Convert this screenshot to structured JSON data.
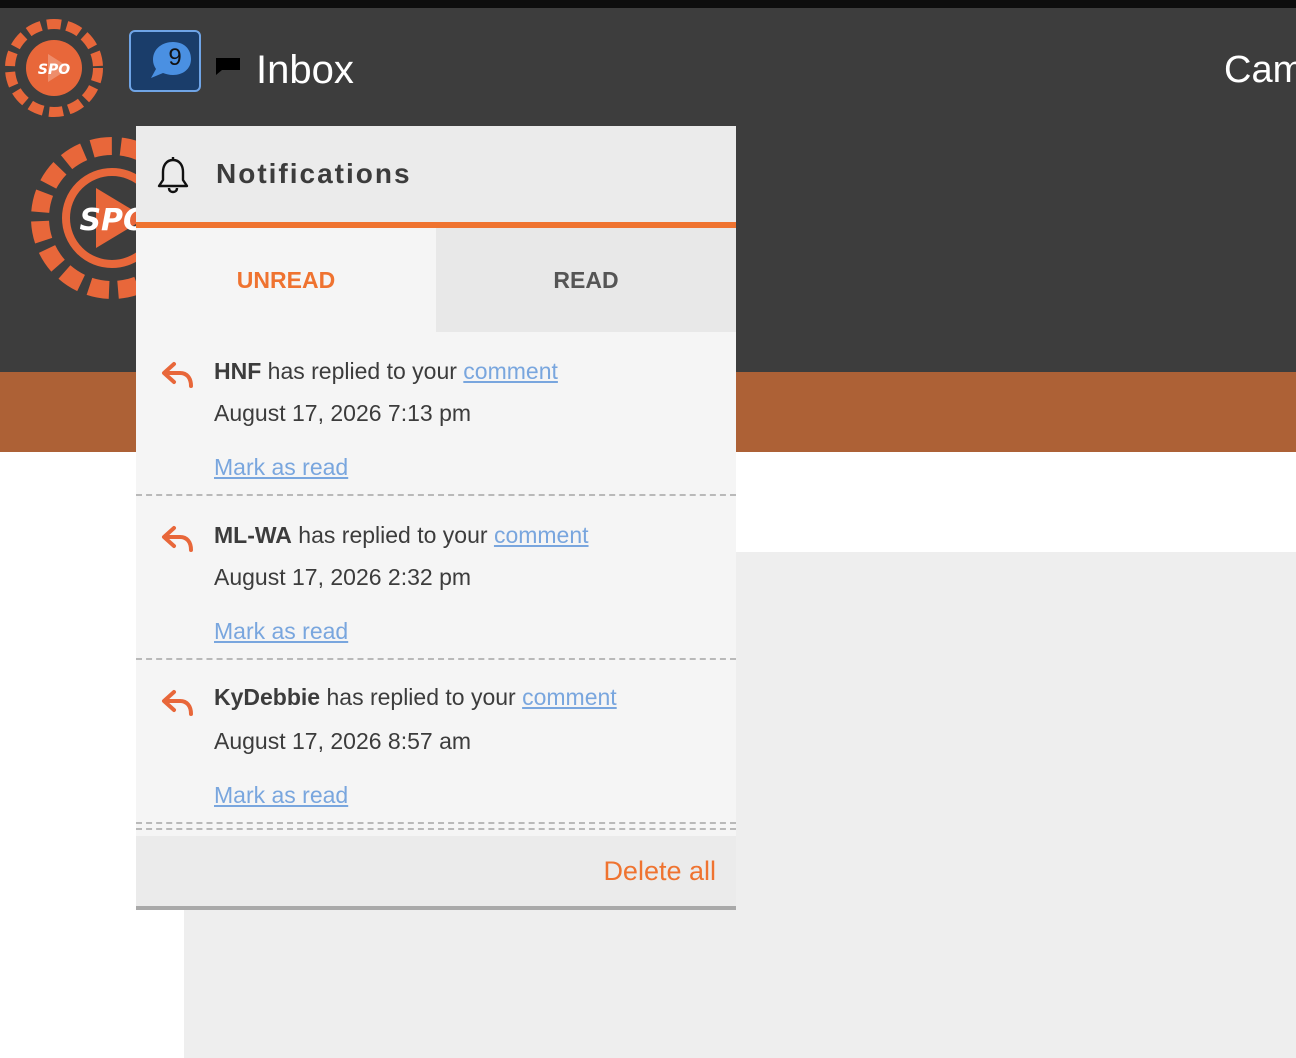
{
  "header": {
    "inbox_label": "Inbox",
    "unread_count": "9",
    "right_link_partial": "Cam",
    "logo_text": "SPO"
  },
  "notifications": {
    "title": "Notifications",
    "tabs": [
      {
        "label": "UNREAD",
        "active": true
      },
      {
        "label": "READ",
        "active": false
      }
    ],
    "items": [
      {
        "user": "HNF",
        "text": " has replied to your ",
        "link": "comment",
        "time": "August 17, 2026 7:13 pm",
        "action": "Mark as read"
      },
      {
        "user": "ML-WA",
        "text": " has replied to your ",
        "link": "comment",
        "time": "August 17, 2026 2:32 pm",
        "action": "Mark as read"
      },
      {
        "user": "KyDebbie",
        "text": " has replied to your ",
        "link": "comment",
        "time": "August 17, 2026 8:57 am",
        "action": "Mark as read"
      }
    ],
    "delete_all_label": "Delete all"
  },
  "colors": {
    "header_bg": "#3d3d3d",
    "accent_orange": "#ef7330",
    "band_orange": "#ad6136",
    "link_blue": "#79a6de",
    "badge_blue": "#4a90e2"
  },
  "icons": {
    "logo": "spo-gear-logo",
    "inbox": "chat-bubble-icon",
    "flag": "flag-icon",
    "bell": "bell-icon",
    "reply": "reply-arrow-icon"
  }
}
